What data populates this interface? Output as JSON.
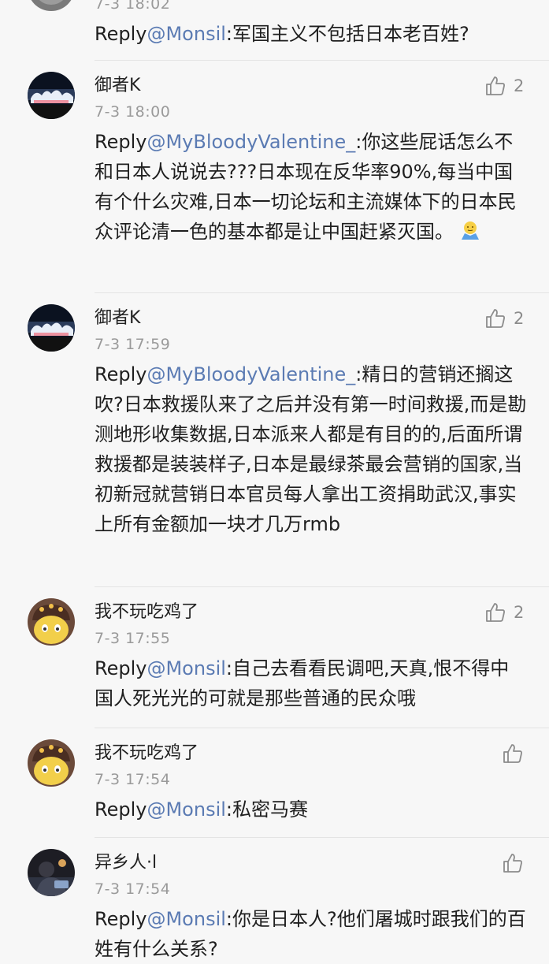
{
  "top_partial": {
    "time": "7-3 18:02",
    "reply_prefix": "Reply",
    "mention": "@Monsil",
    "text": ":军国主义不包括日本老百姓?"
  },
  "comments": [
    {
      "username": "御者K",
      "time": "7-3 18:00",
      "likes": "2",
      "reply_prefix": "Reply",
      "mention": "@MyBloodyValentine_",
      "text": ":你这些屁话怎么不和日本人说说去???日本现在反华率90%,每当中国有个什么灾难,日本一切论坛和主流媒体下的日本民众评论清一色的基本都是让中国赶紧灭国。",
      "emoji": "shrug-emoji"
    },
    {
      "username": "御者K",
      "time": "7-3 17:59",
      "likes": "2",
      "reply_prefix": "Reply",
      "mention": "@MyBloodyValentine_",
      "text": ":精日的营销还搁这吹?日本救援队来了之后并没有第一时间救援,而是勘测地形收集数据,日本派来人都是有目的的,后面所谓救援都是装装样子,日本是最绿茶最会营销的国家,当初新冠就营销日本官员每人拿出工资捐助武汉,事实上所有金额加一块才几万rmb"
    },
    {
      "username": "我不玩吃鸡了",
      "time": "7-3 17:55",
      "likes": "2",
      "reply_prefix": "Reply",
      "mention": "@Monsil",
      "text": ":自己去看看民调吧,天真,恨不得中国人死光光的可就是那些普通的民众哦"
    },
    {
      "username": "我不玩吃鸡了",
      "time": "7-3 17:54",
      "likes": "",
      "reply_prefix": "Reply",
      "mention": "@Monsil",
      "text": ":私密马赛"
    },
    {
      "username": "异乡人·l",
      "time": "7-3 17:54",
      "likes": "",
      "reply_prefix": "Reply",
      "mention": "@Monsil",
      "text": ":你是日本人?他们屠城时跟我们的百姓有什么关系?"
    }
  ],
  "colors": {
    "mention": "#5b7bb3",
    "time": "#9a9a9a",
    "background": "#f7f7f7"
  },
  "icons": {
    "like": "thumbs-up-icon"
  }
}
